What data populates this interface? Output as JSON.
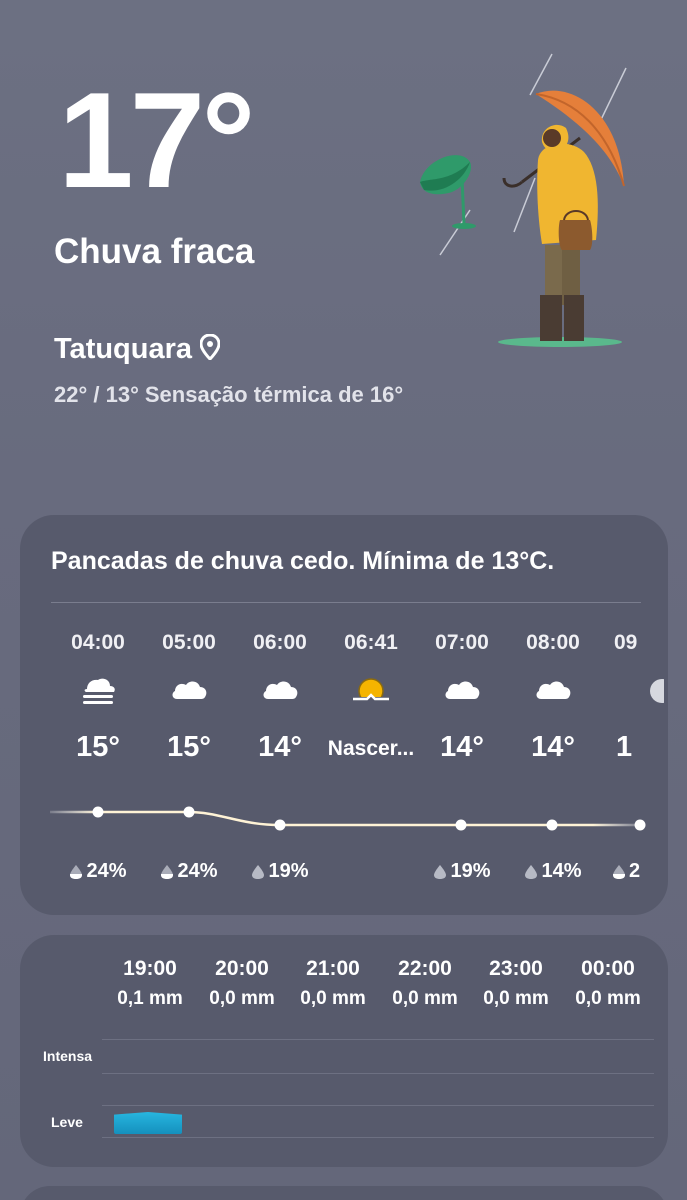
{
  "current": {
    "temperature": "17°",
    "condition": "Chuva fraca",
    "location": "Tatuquara",
    "hi_lo": "22° / 13°",
    "feels_like": "Sensação térmica de 16°"
  },
  "forecast_card": {
    "summary": "Pancadas de chuva cedo. Mínima de 13°C.",
    "hours": [
      {
        "time": "04:00",
        "icon": "fog-icon",
        "temp": "15°",
        "precip": "24%"
      },
      {
        "time": "05:00",
        "icon": "cloud-icon",
        "temp": "15°",
        "precip": "24%"
      },
      {
        "time": "06:00",
        "icon": "cloud-icon",
        "temp": "14°",
        "precip": "19%"
      },
      {
        "time": "06:41",
        "icon": "sunrise-icon",
        "temp": "Nascer...",
        "precip": ""
      },
      {
        "time": "07:00",
        "icon": "cloud-icon",
        "temp": "14°",
        "precip": "19%"
      },
      {
        "time": "08:00",
        "icon": "cloud-icon",
        "temp": "14°",
        "precip": "14%"
      },
      {
        "time": "09",
        "icon": "moon-icon",
        "temp": "1",
        "precip": "2"
      }
    ]
  },
  "rain_card": {
    "hours": [
      {
        "time": "19:00",
        "amount": "0,1 mm"
      },
      {
        "time": "20:00",
        "amount": "0,0 mm"
      },
      {
        "time": "21:00",
        "amount": "0,0 mm"
      },
      {
        "time": "22:00",
        "amount": "0,0 mm"
      },
      {
        "time": "23:00",
        "amount": "0,0 mm"
      },
      {
        "time": "00:00",
        "amount": "0,0 mm"
      }
    ],
    "levels": {
      "high": "Intensa",
      "low": "Leve"
    }
  },
  "colors": {
    "background": "#686b7e",
    "card": "#575a6c",
    "rain_bar": "#1fa6d2",
    "sun": "#f5b400"
  }
}
